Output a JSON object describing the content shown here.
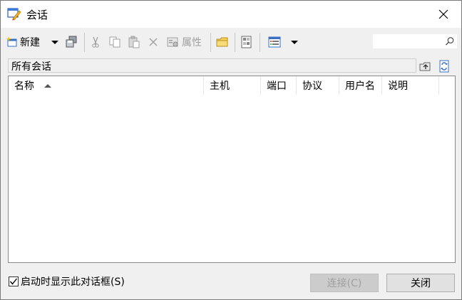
{
  "window": {
    "title": "会话"
  },
  "toolbar": {
    "new_label": "新建",
    "properties_label": "属性"
  },
  "search": {
    "placeholder": ""
  },
  "folder_bar": {
    "label": "所有会话"
  },
  "list": {
    "columns": [
      "名称",
      "主机",
      "端口",
      "协议",
      "用户名",
      "说明"
    ],
    "sort_column": "名称",
    "rows": []
  },
  "footer": {
    "show_on_startup_label": "启动时显示此对话框(S)",
    "show_on_startup_checked": true,
    "connect_label": "连接(C)",
    "close_label": "关闭"
  },
  "colors": {
    "window_bg": "#f0f0f0",
    "list_bg": "#ffffff",
    "disabled_text": "#a0a0a0"
  }
}
